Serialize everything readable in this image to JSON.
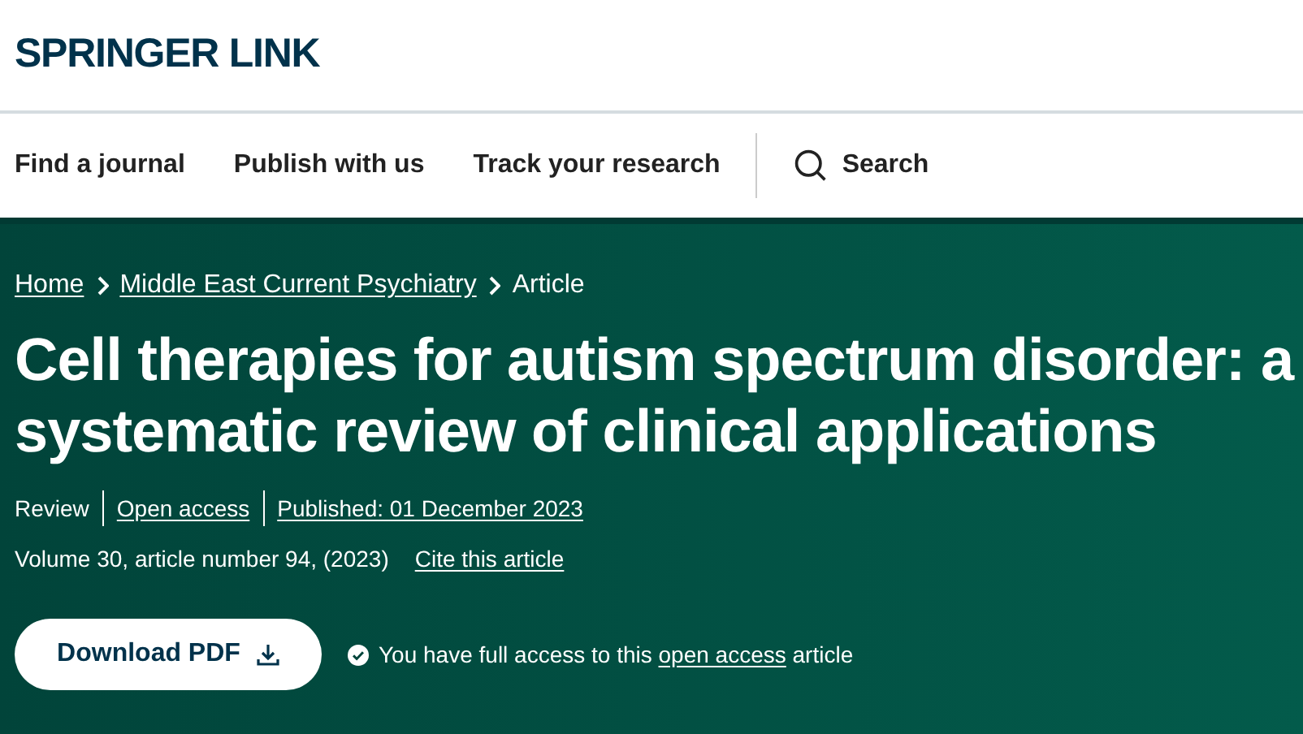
{
  "header": {
    "logo": "SPRINGER LINK"
  },
  "nav": {
    "items": [
      "Find a journal",
      "Publish with us",
      "Track your research"
    ],
    "search": "Search"
  },
  "breadcrumb": [
    {
      "label": "Home",
      "link": true
    },
    {
      "label": "Middle East Current Psychiatry",
      "link": true
    },
    {
      "label": "Article",
      "link": false
    }
  ],
  "article": {
    "title": "Cell therapies for autism spectrum disorder: a systematic review of clinical applications",
    "meta": [
      {
        "label": "Review",
        "link": false
      },
      {
        "label": "Open access",
        "link": true
      },
      {
        "label": "Published: 01 December 2023",
        "link": true
      }
    ],
    "citation": "Volume 30, article number 94, (2023)",
    "cite_link": "Cite this article",
    "download_button": "Download PDF",
    "access_note": {
      "before": "You have full access to this",
      "link": "open access",
      "after": "article"
    }
  }
}
